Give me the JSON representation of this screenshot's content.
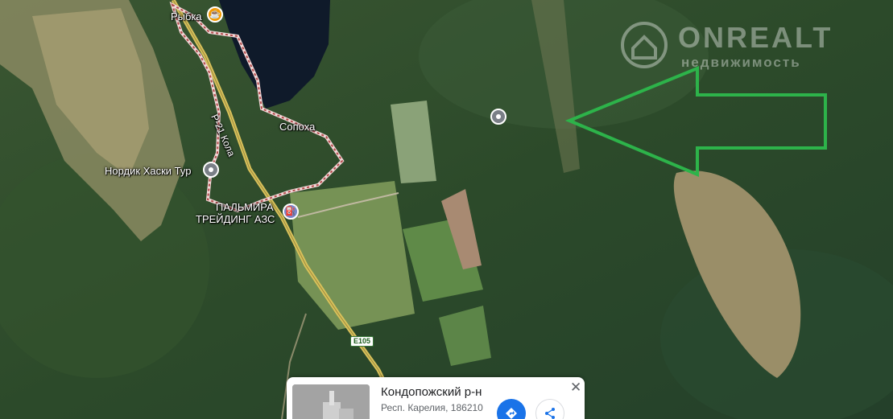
{
  "map": {
    "labels": {
      "rybka": "Рыбка",
      "sopokha": "Сопоха",
      "nordik": "Нордик Хаски Тур",
      "palmira_1": "ПАЛЬМИРА",
      "palmira_2": "ТРЕЙДИНГ АЗС",
      "road": "Р-21 Кола",
      "route_shield": "E105"
    },
    "icons": {
      "cafe": "cafe-icon",
      "gas": "gas-station-icon",
      "place": "place-pin-icon"
    }
  },
  "watermark": {
    "brand": "ONREALT",
    "tagline": "недвижимость"
  },
  "info_card": {
    "title": "Кондопожский р-н",
    "subtitle": "Респ. Карелия, 186210",
    "close_label": "✕",
    "directions_icon": "directions-icon",
    "share_icon": "share-icon"
  },
  "colors": {
    "arrow": "#2db34a",
    "boundary": "#f1d7d7",
    "lake": "#0f1a2a",
    "road": "#d8c15a"
  }
}
